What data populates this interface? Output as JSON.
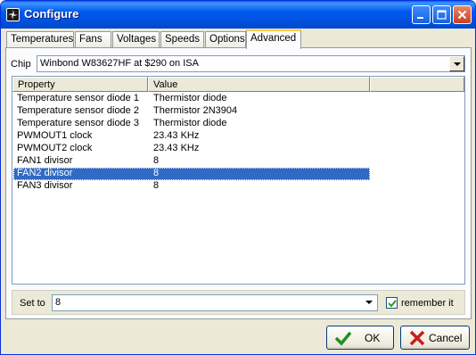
{
  "window": {
    "title": "Configure",
    "icon": "fan-icon",
    "accent": "#0054e3"
  },
  "tabs": [
    {
      "label": "Temperatures"
    },
    {
      "label": "Fans"
    },
    {
      "label": "Voltages"
    },
    {
      "label": "Speeds"
    },
    {
      "label": "Options"
    },
    {
      "label": "Advanced",
      "active": true
    }
  ],
  "chip": {
    "label": "Chip",
    "value": "Winbond W83627HF at $290 on ISA"
  },
  "table": {
    "columns": [
      "Property",
      "Value"
    ],
    "rows": [
      {
        "property": "Temperature sensor diode 1",
        "value": "Thermistor diode"
      },
      {
        "property": "Temperature sensor diode 2",
        "value": "Thermistor 2N3904"
      },
      {
        "property": "Temperature sensor diode 3",
        "value": "Thermistor diode"
      },
      {
        "property": "PWMOUT1 clock",
        "value": "23.43 KHz"
      },
      {
        "property": "PWMOUT2 clock",
        "value": "23.43 KHz"
      },
      {
        "property": "FAN1 divisor",
        "value": "8"
      },
      {
        "property": "FAN2 divisor",
        "value": "8",
        "selected": true
      },
      {
        "property": "FAN3 divisor",
        "value": "8"
      }
    ],
    "selection_color": "#316ac5"
  },
  "set_to": {
    "label": "Set to",
    "value": "8"
  },
  "remember": {
    "label": "remember it",
    "checked": true
  },
  "buttons": {
    "ok": "OK",
    "cancel": "Cancel"
  }
}
